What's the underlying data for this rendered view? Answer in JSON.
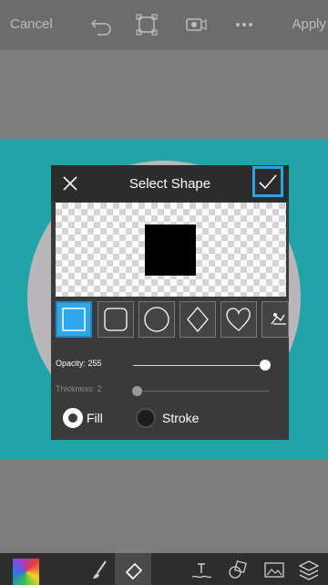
{
  "toolbar": {
    "cancel_label": "Cancel",
    "apply_label": "Apply",
    "icons": [
      "undo-icon",
      "crop-icon",
      "video-icon",
      "more-icon"
    ]
  },
  "dialog": {
    "title": "Select Shape",
    "shapes": [
      "square",
      "rounded-square",
      "circle",
      "diamond",
      "heart",
      "custom"
    ],
    "selected_shape": "square",
    "opacity_label": "Opacity: 255",
    "opacity_fraction": 1.0,
    "thickness_label": "Thickness: 2",
    "thickness_fraction": 0.0,
    "fill_label": "Fill",
    "stroke_label": "Stroke",
    "selected_mode": "Fill"
  },
  "bottom_tools": [
    "color-picker",
    "brush",
    "eraser",
    "text",
    "shape",
    "image",
    "layers"
  ],
  "colors": {
    "accent": "#2aa4e4",
    "teal_canvas": "#21a3a7",
    "circle_fill": "#b9b7ba"
  }
}
